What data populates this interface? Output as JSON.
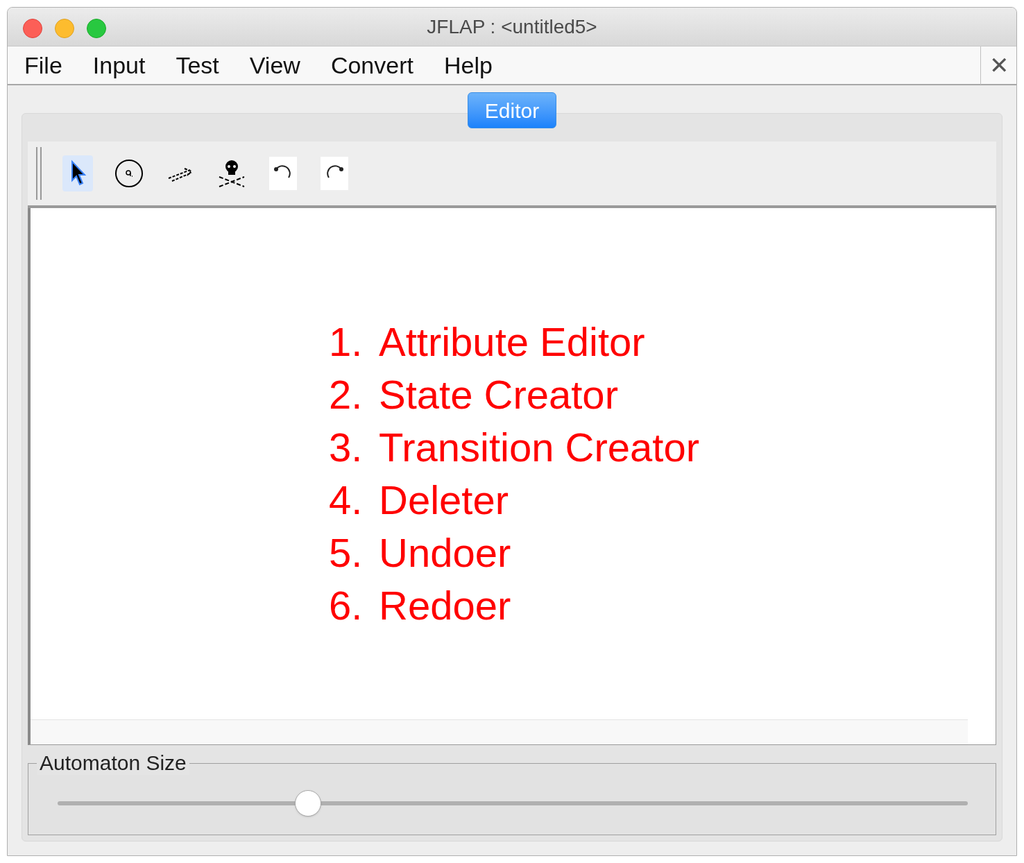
{
  "window": {
    "title": "JFLAP : <untitled5>"
  },
  "menu": [
    "File",
    "Input",
    "Test",
    "View",
    "Convert",
    "Help"
  ],
  "close_label": "✕",
  "tabs": [
    {
      "label": "Editor",
      "selected": true
    }
  ],
  "toolbar": [
    {
      "kind": "select",
      "selected": true
    },
    {
      "kind": "state",
      "selected": false
    },
    {
      "kind": "transition",
      "selected": false
    },
    {
      "kind": "delete",
      "selected": false
    },
    {
      "kind": "undo",
      "selected": false
    },
    {
      "kind": "redo",
      "selected": false
    }
  ],
  "annotations": [
    {
      "number": "1.",
      "label": "Attribute Editor"
    },
    {
      "number": "2.",
      "label": "State Creator"
    },
    {
      "number": "3.",
      "label": "Transition Creator"
    },
    {
      "number": "4.",
      "label": "Deleter"
    },
    {
      "number": "5.",
      "label": "Undoer"
    },
    {
      "number": "6.",
      "label": "Redoer"
    }
  ],
  "size_panel": {
    "title": "Automaton Size",
    "level": 0.275
  }
}
